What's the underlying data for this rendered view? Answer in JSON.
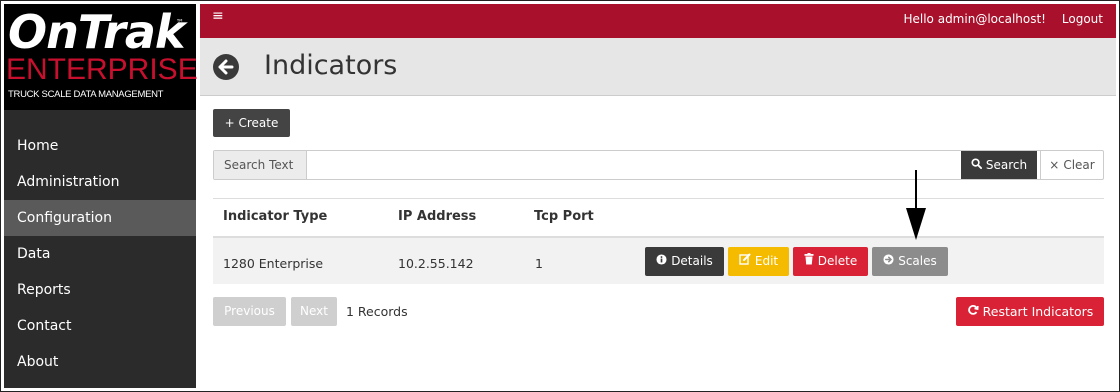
{
  "brand": {
    "name": "OnTrak",
    "trademark": "™",
    "edition": "ENTERPRISE",
    "tagline": "TRUCK SCALE DATA MANAGEMENT"
  },
  "sidebar": {
    "items": [
      {
        "label": "Home"
      },
      {
        "label": "Administration"
      },
      {
        "label": "Configuration"
      },
      {
        "label": "Data"
      },
      {
        "label": "Reports"
      },
      {
        "label": "Contact"
      },
      {
        "label": "About"
      }
    ]
  },
  "topbar": {
    "menu_icon": "≡",
    "greeting": "Hello admin@localhost!",
    "logout_label": "Logout"
  },
  "header": {
    "title": "Indicators"
  },
  "toolbar": {
    "create_label": "+ Create"
  },
  "search": {
    "label": "Search Text",
    "value": "",
    "placeholder": "",
    "search_label": "Search",
    "clear_label": "Clear"
  },
  "table": {
    "columns": [
      "Indicator Type",
      "IP Address",
      "Tcp Port"
    ],
    "rows": [
      {
        "indicator_type": "1280 Enterprise",
        "ip_address": "10.2.55.142",
        "tcp_port": "1",
        "actions": {
          "details": "Details",
          "edit": "Edit",
          "delete": "Delete",
          "scales": "Scales"
        }
      }
    ]
  },
  "pagination": {
    "previous_label": "Previous",
    "next_label": "Next",
    "records_text": "1 Records"
  },
  "restart_label": "Restart Indicators",
  "colors": {
    "brand_red": "#a8102b",
    "sidebar_bg": "#2b2b2b",
    "sidebar_active": "#5a5a5a",
    "warning": "#f5bb00",
    "danger": "#d92235",
    "secondary": "#8c8c8c",
    "dark": "#3a3a3a"
  },
  "icons": {
    "back": "arrow-left-circle-icon",
    "search": "magnifier-icon",
    "clear": "x-icon",
    "details": "info-circle-icon",
    "edit": "pencil-square-icon",
    "delete": "trash-icon",
    "scales": "arrow-right-circle-icon",
    "restart": "refresh-icon",
    "annotation": "down-arrow-icon"
  }
}
